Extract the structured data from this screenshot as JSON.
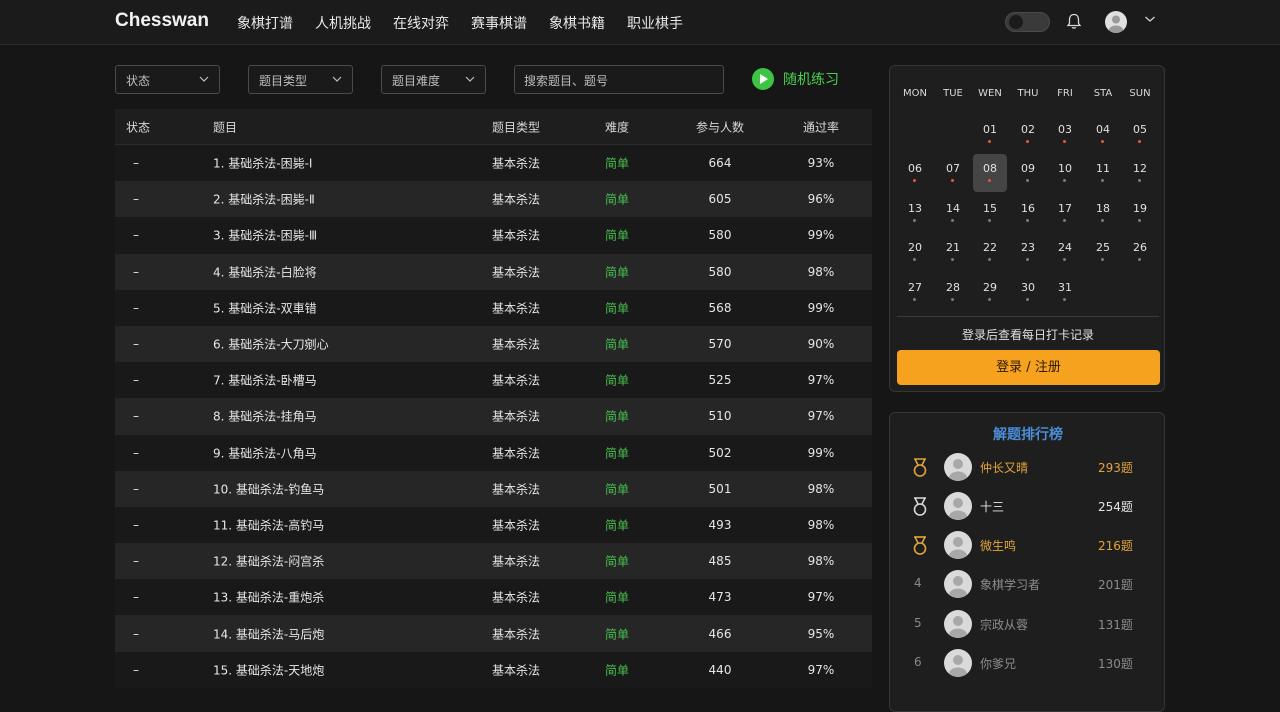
{
  "header": {
    "logo": "Chesswan",
    "nav": [
      "象棋打谱",
      "人机挑战",
      "在线对弈",
      "赛事棋谱",
      "象棋书籍",
      "职业棋手"
    ]
  },
  "filters": {
    "status": "状态",
    "type": "题目类型",
    "difficulty": "题目难度",
    "search_placeholder": "搜索题目、题号",
    "random": "随机练习"
  },
  "table": {
    "headers": {
      "status": "状态",
      "title": "题目",
      "type": "题目类型",
      "difficulty": "难度",
      "participants": "参与人数",
      "pass_rate": "通过率"
    },
    "rows": [
      {
        "status": "–",
        "title": "1. 基础杀法-困毙-Ⅰ",
        "type": "基本杀法",
        "difficulty": "简单",
        "participants": "664",
        "pass_rate": "93%"
      },
      {
        "status": "–",
        "title": "2. 基础杀法-困毙-Ⅱ",
        "type": "基本杀法",
        "difficulty": "简单",
        "participants": "605",
        "pass_rate": "96%"
      },
      {
        "status": "–",
        "title": "3. 基础杀法-困毙-Ⅲ",
        "type": "基本杀法",
        "difficulty": "简单",
        "participants": "580",
        "pass_rate": "99%"
      },
      {
        "status": "–",
        "title": "4. 基础杀法-白脸将",
        "type": "基本杀法",
        "difficulty": "简单",
        "participants": "580",
        "pass_rate": "98%"
      },
      {
        "status": "–",
        "title": "5. 基础杀法-双車错",
        "type": "基本杀法",
        "difficulty": "简单",
        "participants": "568",
        "pass_rate": "99%"
      },
      {
        "status": "–",
        "title": "6. 基础杀法-大刀剜心",
        "type": "基本杀法",
        "difficulty": "简单",
        "participants": "570",
        "pass_rate": "90%"
      },
      {
        "status": "–",
        "title": "7. 基础杀法-卧槽马",
        "type": "基本杀法",
        "difficulty": "简单",
        "participants": "525",
        "pass_rate": "97%"
      },
      {
        "status": "–",
        "title": "8. 基础杀法-挂角马",
        "type": "基本杀法",
        "difficulty": "简单",
        "participants": "510",
        "pass_rate": "97%"
      },
      {
        "status": "–",
        "title": "9. 基础杀法-八角马",
        "type": "基本杀法",
        "difficulty": "简单",
        "participants": "502",
        "pass_rate": "99%"
      },
      {
        "status": "–",
        "title": "10. 基础杀法-钓鱼马",
        "type": "基本杀法",
        "difficulty": "简单",
        "participants": "501",
        "pass_rate": "98%"
      },
      {
        "status": "–",
        "title": "11. 基础杀法-高钓马",
        "type": "基本杀法",
        "difficulty": "简单",
        "participants": "493",
        "pass_rate": "98%"
      },
      {
        "status": "–",
        "title": "12. 基础杀法-闷宫杀",
        "type": "基本杀法",
        "difficulty": "简单",
        "participants": "485",
        "pass_rate": "98%"
      },
      {
        "status": "–",
        "title": "13. 基础杀法-重炮杀",
        "type": "基本杀法",
        "difficulty": "简单",
        "participants": "473",
        "pass_rate": "97%"
      },
      {
        "status": "–",
        "title": "14. 基础杀法-马后炮",
        "type": "基本杀法",
        "difficulty": "简单",
        "participants": "466",
        "pass_rate": "95%"
      },
      {
        "status": "–",
        "title": "15. 基础杀法-天地炮",
        "type": "基本杀法",
        "difficulty": "简单",
        "participants": "440",
        "pass_rate": "97%"
      }
    ]
  },
  "calendar": {
    "weekdays": [
      "MON",
      "TUE",
      "WEN",
      "THU",
      "FRI",
      "STA",
      "SUN"
    ],
    "days": [
      {
        "n": "01",
        "dot": "red"
      },
      {
        "n": "02",
        "dot": "red"
      },
      {
        "n": "03",
        "dot": "red"
      },
      {
        "n": "04",
        "dot": "red"
      },
      {
        "n": "05",
        "dot": "red"
      },
      {
        "n": "06",
        "dot": "red"
      },
      {
        "n": "07",
        "dot": "red"
      },
      {
        "n": "08",
        "dot": "red",
        "today": true
      },
      {
        "n": "09",
        "dot": "gray"
      },
      {
        "n": "10",
        "dot": "gray"
      },
      {
        "n": "11",
        "dot": "gray"
      },
      {
        "n": "12",
        "dot": "gray"
      },
      {
        "n": "13",
        "dot": "gray"
      },
      {
        "n": "14",
        "dot": "gray"
      },
      {
        "n": "15",
        "dot": "gray"
      },
      {
        "n": "16",
        "dot": "gray"
      },
      {
        "n": "17",
        "dot": "gray"
      },
      {
        "n": "18",
        "dot": "gray"
      },
      {
        "n": "19",
        "dot": "gray"
      },
      {
        "n": "20",
        "dot": "gray"
      },
      {
        "n": "21",
        "dot": "gray"
      },
      {
        "n": "22",
        "dot": "gray"
      },
      {
        "n": "23",
        "dot": "gray"
      },
      {
        "n": "24",
        "dot": "gray"
      },
      {
        "n": "25",
        "dot": "gray"
      },
      {
        "n": "26",
        "dot": "gray"
      },
      {
        "n": "27",
        "dot": "gray"
      },
      {
        "n": "28",
        "dot": "gray"
      },
      {
        "n": "29",
        "dot": "gray"
      },
      {
        "n": "30",
        "dot": "gray"
      },
      {
        "n": "31",
        "dot": "gray"
      }
    ],
    "note": "登录后查看每日打卡记录",
    "login_label": "登录 / 注册"
  },
  "ranking": {
    "title": "解题排行榜",
    "entries": [
      {
        "rank": "1",
        "name": "仲长又晴",
        "count": "293题",
        "tone": "gold",
        "medal": "gold"
      },
      {
        "rank": "2",
        "name": "十三",
        "count": "254题",
        "tone": "white",
        "medal": "silver"
      },
      {
        "rank": "3",
        "name": "微生鸣",
        "count": "216题",
        "tone": "gold",
        "medal": "bronze"
      },
      {
        "rank": "4",
        "name": "象棋学习者",
        "count": "201题",
        "tone": "gray"
      },
      {
        "rank": "5",
        "name": "宗政从蓉",
        "count": "131题",
        "tone": "gray"
      },
      {
        "rank": "6",
        "name": "你爹兄",
        "count": "130题",
        "tone": "gray"
      }
    ]
  },
  "colors": {
    "accent_orange": "#f7a21e",
    "easy_green": "#48c04e",
    "rank_title_blue": "#4a8cd6",
    "medal_gold": "#e1a43c"
  }
}
